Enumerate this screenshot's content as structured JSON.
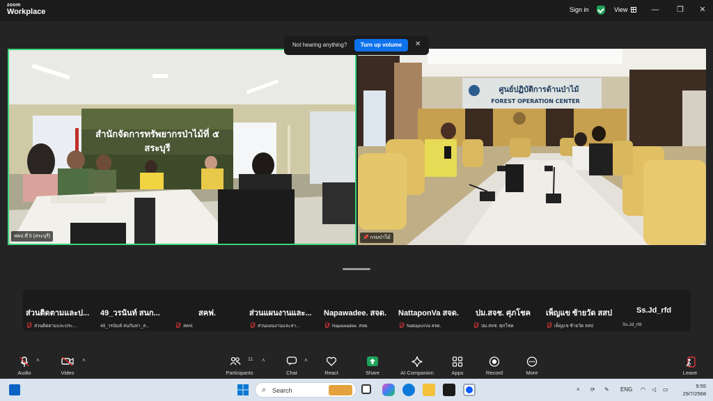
{
  "titlebar": {
    "logo_line1": "zoom",
    "logo_line2": "Workplace",
    "signin": "Sign in",
    "view": "View",
    "minimize": "—",
    "restore": "❐",
    "close": "✕"
  },
  "notification": {
    "message": "Not hearing anything?",
    "button": "Turn up volume",
    "close": "✕"
  },
  "tiles": [
    {
      "name": "สคป.ที่ 5 (สระบุรี)"
    },
    {
      "name": "กรมป่าไม้"
    }
  ],
  "video_text": {
    "banner_line1": "สำนักจัดการทรัพยากรป่าไม้ที่ ๕",
    "banner_line2": "สระบุรี",
    "sign_line1": "ศูนย์ปฏิบัติการด้านป่าไม้",
    "sign_line2": "FOREST OPERATION CENTER"
  },
  "participants_strip": [
    {
      "display": "ส่วนติดตามและป...",
      "name": "ส่วนติดตามและประ..."
    },
    {
      "display": "49_วรนันท์ สนก...",
      "name": "49_วรนันท์ สนกันทา_ส..."
    },
    {
      "display": "สคฟ.",
      "name": "สคฟ."
    },
    {
      "display": "ส่วนแผนงานและ...",
      "name": "ส่วนแผนงานและสา..."
    },
    {
      "display": "Napawadee. สจด.",
      "name": "Napawadee. สจด."
    },
    {
      "display": "NattaponVa สจด.",
      "name": "NattaponVa สจด."
    },
    {
      "display": "ปม.สจช. ศุภโชค",
      "name": "ปม.สจช. ศุภโชค"
    },
    {
      "display": "เพ็ญแข ซ้ายวัด สสป",
      "name": "เพ็ญแข ซ้ายวัด สสป"
    },
    {
      "display": "Ss.Jd_rfd",
      "name": "Ss.Jd_rfd"
    }
  ],
  "toolbar": {
    "audio": "Audio",
    "video": "Video",
    "participants": "Participants",
    "participants_count": "11",
    "chat": "Chat",
    "react": "React",
    "share": "Share",
    "ai_companion": "AI Companion",
    "apps": "Apps",
    "record": "Record",
    "more": "More",
    "leave": "Leave"
  },
  "taskbar": {
    "search_placeholder": "Search",
    "language": "ENG",
    "time": "9:55",
    "date": "29/7/2568"
  },
  "colors": {
    "active_border": "#3ad67c",
    "primary_button": "#0e72ed",
    "muted_red": "#e0343a",
    "share_green": "#1fa35b"
  }
}
